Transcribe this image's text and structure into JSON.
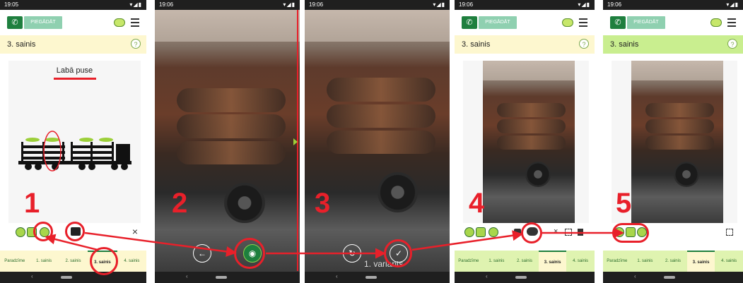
{
  "status_time_1": "19:05",
  "status_time_other": "19:06",
  "app": {
    "deliver_label": "PIEGĀDĀT",
    "screen_title": "3. sainis",
    "help": "?"
  },
  "panel1": {
    "heading": "Labā puse",
    "close": "×"
  },
  "tabs": [
    "Paradzīme",
    "1. sainis",
    "2. sainis",
    "3. sainis",
    "4. sainis"
  ],
  "active_tab": 3,
  "panel3": {
    "variant_label": "1. variants"
  },
  "steps": [
    "1",
    "2",
    "3",
    "4",
    "5"
  ],
  "colors": {
    "accent_green": "#1e7f3e",
    "highlight_red": "#e8202a",
    "title_yellow": "#fdf7cf",
    "title_green": "#c9ee8f"
  },
  "icons": [
    "phone-icon",
    "cloud-icon",
    "menu-icon",
    "help-icon",
    "camera-icon",
    "back-arrow-icon",
    "refresh-icon",
    "check-icon",
    "cloud-upload-icon",
    "expand-icon",
    "delete-icon"
  ]
}
